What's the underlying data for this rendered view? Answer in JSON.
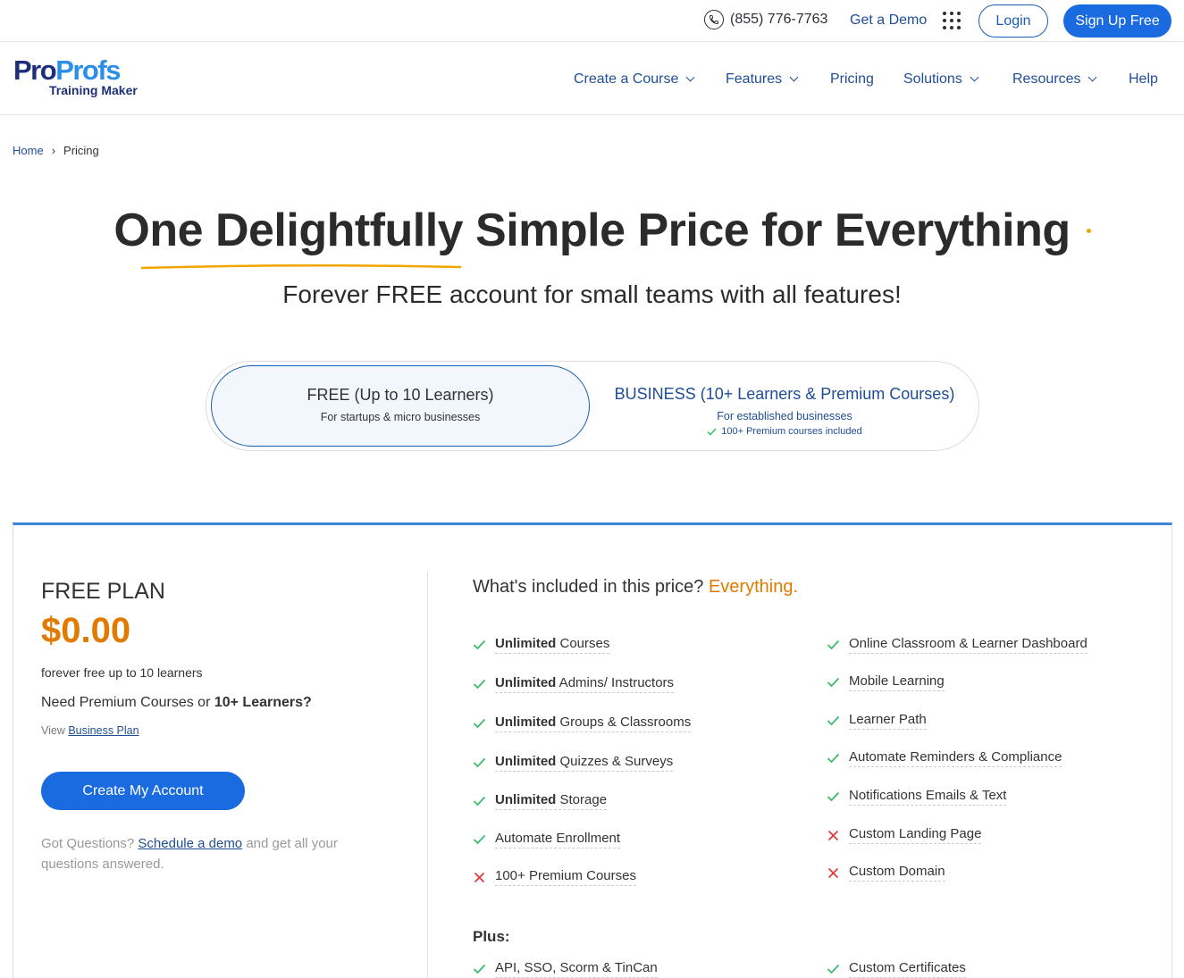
{
  "topbar": {
    "phone": "(855) 776-7763",
    "demo": "Get a Demo",
    "login": "Login",
    "signup": "Sign Up Free"
  },
  "logo": {
    "pro": "Pro",
    "profs": "Profs",
    "sub": "Training Maker"
  },
  "nav": {
    "create_course": "Create a Course",
    "features": "Features",
    "pricing": "Pricing",
    "solutions": "Solutions",
    "resources": "Resources",
    "help": "Help"
  },
  "breadcrumb": {
    "home": "Home",
    "sep": "›",
    "current": "Pricing"
  },
  "hero": {
    "title": "One Delightfully Simple Price for Everything",
    "subtitle": "Forever FREE account for small teams with all features!"
  },
  "toggle": {
    "free_title": "FREE (Up to 10 Learners)",
    "free_sub": "For startups & micro businesses",
    "biz_title": "BUSINESS (10+ Learners & Premium Courses)",
    "biz_sub": "For established businesses",
    "biz_note": "100+ Premium courses included"
  },
  "plan": {
    "name": "FREE PLAN",
    "price": "$0.00",
    "desc": "forever free up to 10 learners",
    "need_prefix": "Need Premium Courses or ",
    "need_bold": "10+ Learners?",
    "view_prefix": "View ",
    "view_link": "Business Plan",
    "create_btn": "Create My Account",
    "questions_prefix": "Got Questions? ",
    "questions_link": "Schedule a demo",
    "questions_suffix": " and get all your questions answered."
  },
  "included": {
    "head": "What's included in this price? ",
    "head_accent": "Everything.",
    "left": [
      {
        "bold": "Unlimited",
        "text": " Courses",
        "ok": true
      },
      {
        "bold": "Unlimited",
        "text": " Admins/ Instructors",
        "ok": true
      },
      {
        "bold": "Unlimited",
        "text": " Groups & Classrooms",
        "ok": true
      },
      {
        "bold": "Unlimited",
        "text": " Quizzes & Surveys",
        "ok": true
      },
      {
        "bold": "Unlimited",
        "text": " Storage",
        "ok": true
      },
      {
        "bold": "",
        "text": "Automate Enrollment",
        "ok": true
      },
      {
        "bold": "",
        "text": "100+ Premium Courses",
        "ok": false
      }
    ],
    "right": [
      {
        "bold": "",
        "text": "Online Classroom & Learner Dashboard",
        "ok": true
      },
      {
        "bold": "",
        "text": "Mobile Learning",
        "ok": true
      },
      {
        "bold": "",
        "text": "Learner Path",
        "ok": true
      },
      {
        "bold": "",
        "text": "Automate Reminders & Compliance",
        "ok": true
      },
      {
        "bold": "",
        "text": "Notifications Emails & Text",
        "ok": true
      },
      {
        "bold": "",
        "text": "Custom Landing Page",
        "ok": false
      },
      {
        "bold": "",
        "text": "Custom Domain",
        "ok": false
      }
    ],
    "plus": "Plus:",
    "plus_left": [
      {
        "bold": "",
        "text": "API, SSO, Scorm & TinCan",
        "ok": true
      }
    ],
    "plus_right": [
      {
        "bold": "",
        "text": "Custom Certificates",
        "ok": true
      }
    ]
  },
  "colors": {
    "accent": "#1a6ae0",
    "orange": "#e07b00",
    "check": "#3cba6a",
    "cross": "#e03c3c"
  }
}
